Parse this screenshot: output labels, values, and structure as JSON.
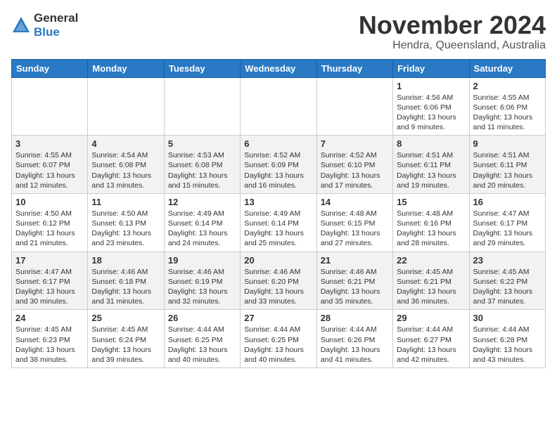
{
  "logo": {
    "text_general": "General",
    "text_blue": "Blue"
  },
  "title": "November 2024",
  "subtitle": "Hendra, Queensland, Australia",
  "weekdays": [
    "Sunday",
    "Monday",
    "Tuesday",
    "Wednesday",
    "Thursday",
    "Friday",
    "Saturday"
  ],
  "weeks": [
    {
      "alt": false,
      "days": [
        {
          "num": "",
          "info": ""
        },
        {
          "num": "",
          "info": ""
        },
        {
          "num": "",
          "info": ""
        },
        {
          "num": "",
          "info": ""
        },
        {
          "num": "",
          "info": ""
        },
        {
          "num": "1",
          "info": "Sunrise: 4:56 AM\nSunset: 6:06 PM\nDaylight: 13 hours\nand 9 minutes."
        },
        {
          "num": "2",
          "info": "Sunrise: 4:55 AM\nSunset: 6:06 PM\nDaylight: 13 hours\nand 11 minutes."
        }
      ]
    },
    {
      "alt": true,
      "days": [
        {
          "num": "3",
          "info": "Sunrise: 4:55 AM\nSunset: 6:07 PM\nDaylight: 13 hours\nand 12 minutes."
        },
        {
          "num": "4",
          "info": "Sunrise: 4:54 AM\nSunset: 6:08 PM\nDaylight: 13 hours\nand 13 minutes."
        },
        {
          "num": "5",
          "info": "Sunrise: 4:53 AM\nSunset: 6:08 PM\nDaylight: 13 hours\nand 15 minutes."
        },
        {
          "num": "6",
          "info": "Sunrise: 4:52 AM\nSunset: 6:09 PM\nDaylight: 13 hours\nand 16 minutes."
        },
        {
          "num": "7",
          "info": "Sunrise: 4:52 AM\nSunset: 6:10 PM\nDaylight: 13 hours\nand 17 minutes."
        },
        {
          "num": "8",
          "info": "Sunrise: 4:51 AM\nSunset: 6:11 PM\nDaylight: 13 hours\nand 19 minutes."
        },
        {
          "num": "9",
          "info": "Sunrise: 4:51 AM\nSunset: 6:11 PM\nDaylight: 13 hours\nand 20 minutes."
        }
      ]
    },
    {
      "alt": false,
      "days": [
        {
          "num": "10",
          "info": "Sunrise: 4:50 AM\nSunset: 6:12 PM\nDaylight: 13 hours\nand 21 minutes."
        },
        {
          "num": "11",
          "info": "Sunrise: 4:50 AM\nSunset: 6:13 PM\nDaylight: 13 hours\nand 23 minutes."
        },
        {
          "num": "12",
          "info": "Sunrise: 4:49 AM\nSunset: 6:14 PM\nDaylight: 13 hours\nand 24 minutes."
        },
        {
          "num": "13",
          "info": "Sunrise: 4:49 AM\nSunset: 6:14 PM\nDaylight: 13 hours\nand 25 minutes."
        },
        {
          "num": "14",
          "info": "Sunrise: 4:48 AM\nSunset: 6:15 PM\nDaylight: 13 hours\nand 27 minutes."
        },
        {
          "num": "15",
          "info": "Sunrise: 4:48 AM\nSunset: 6:16 PM\nDaylight: 13 hours\nand 28 minutes."
        },
        {
          "num": "16",
          "info": "Sunrise: 4:47 AM\nSunset: 6:17 PM\nDaylight: 13 hours\nand 29 minutes."
        }
      ]
    },
    {
      "alt": true,
      "days": [
        {
          "num": "17",
          "info": "Sunrise: 4:47 AM\nSunset: 6:17 PM\nDaylight: 13 hours\nand 30 minutes."
        },
        {
          "num": "18",
          "info": "Sunrise: 4:46 AM\nSunset: 6:18 PM\nDaylight: 13 hours\nand 31 minutes."
        },
        {
          "num": "19",
          "info": "Sunrise: 4:46 AM\nSunset: 6:19 PM\nDaylight: 13 hours\nand 32 minutes."
        },
        {
          "num": "20",
          "info": "Sunrise: 4:46 AM\nSunset: 6:20 PM\nDaylight: 13 hours\nand 33 minutes."
        },
        {
          "num": "21",
          "info": "Sunrise: 4:46 AM\nSunset: 6:21 PM\nDaylight: 13 hours\nand 35 minutes."
        },
        {
          "num": "22",
          "info": "Sunrise: 4:45 AM\nSunset: 6:21 PM\nDaylight: 13 hours\nand 36 minutes."
        },
        {
          "num": "23",
          "info": "Sunrise: 4:45 AM\nSunset: 6:22 PM\nDaylight: 13 hours\nand 37 minutes."
        }
      ]
    },
    {
      "alt": false,
      "days": [
        {
          "num": "24",
          "info": "Sunrise: 4:45 AM\nSunset: 6:23 PM\nDaylight: 13 hours\nand 38 minutes."
        },
        {
          "num": "25",
          "info": "Sunrise: 4:45 AM\nSunset: 6:24 PM\nDaylight: 13 hours\nand 39 minutes."
        },
        {
          "num": "26",
          "info": "Sunrise: 4:44 AM\nSunset: 6:25 PM\nDaylight: 13 hours\nand 40 minutes."
        },
        {
          "num": "27",
          "info": "Sunrise: 4:44 AM\nSunset: 6:25 PM\nDaylight: 13 hours\nand 40 minutes."
        },
        {
          "num": "28",
          "info": "Sunrise: 4:44 AM\nSunset: 6:26 PM\nDaylight: 13 hours\nand 41 minutes."
        },
        {
          "num": "29",
          "info": "Sunrise: 4:44 AM\nSunset: 6:27 PM\nDaylight: 13 hours\nand 42 minutes."
        },
        {
          "num": "30",
          "info": "Sunrise: 4:44 AM\nSunset: 6:28 PM\nDaylight: 13 hours\nand 43 minutes."
        }
      ]
    }
  ]
}
